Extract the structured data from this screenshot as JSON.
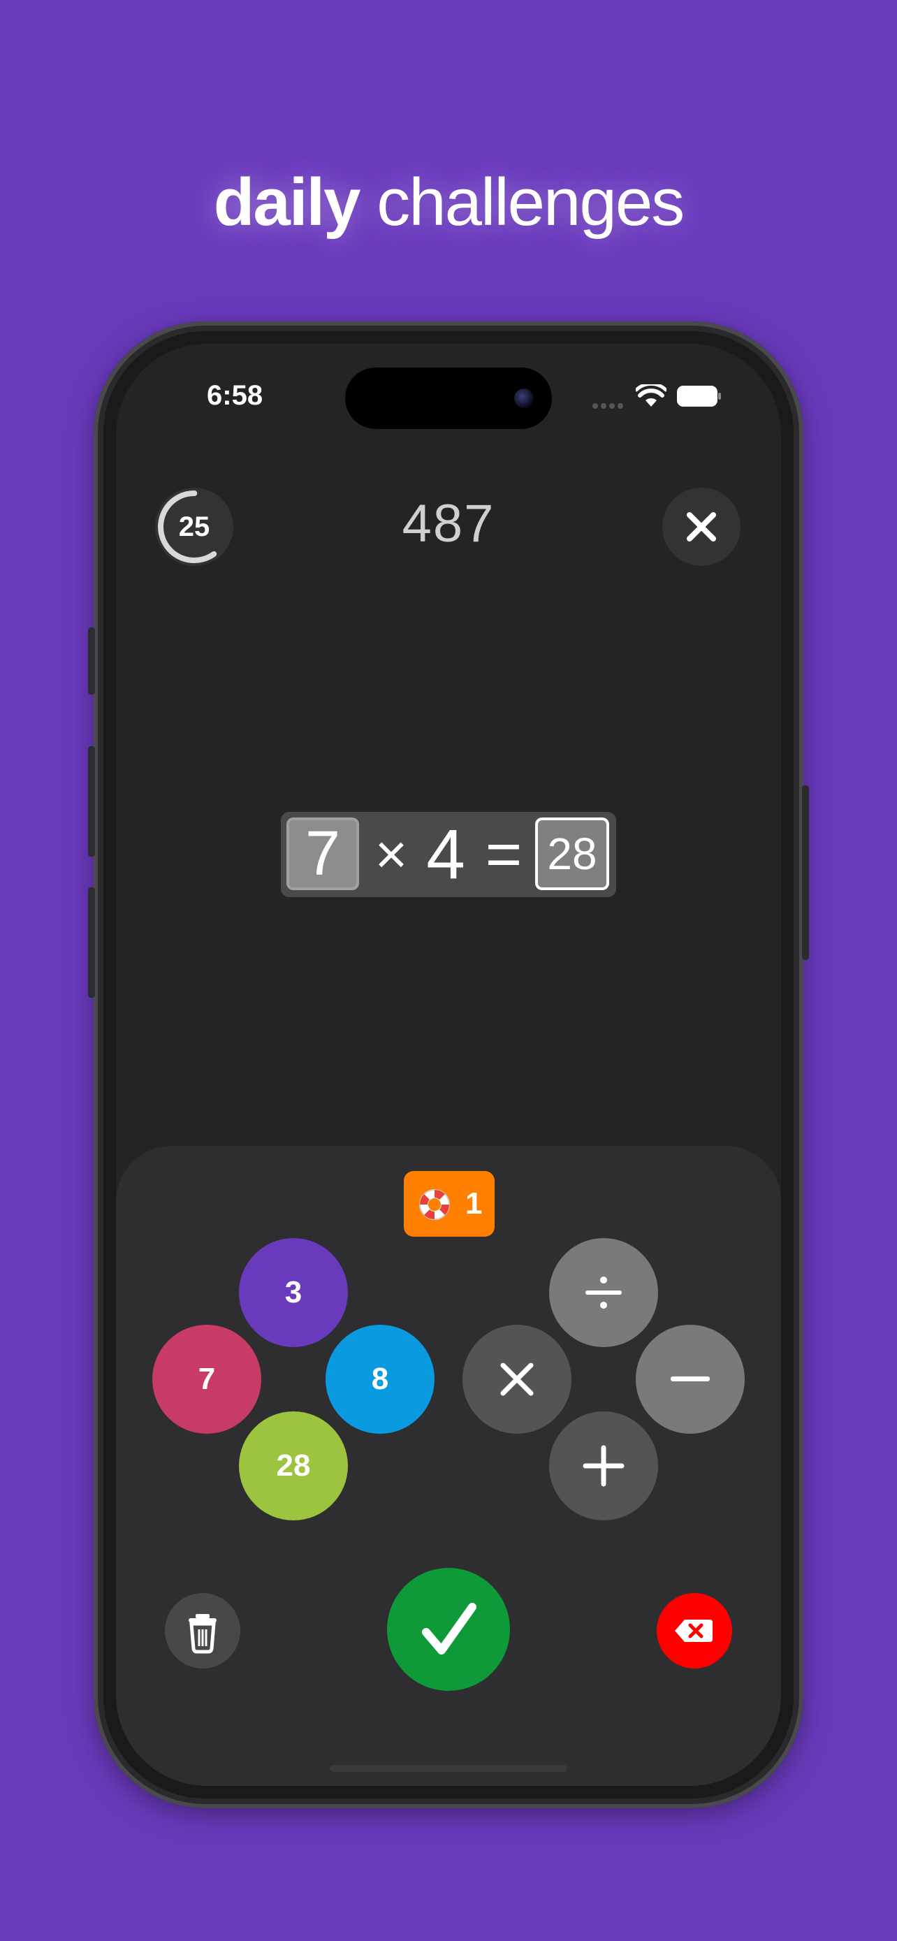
{
  "headline": {
    "bold": "daily",
    "light": " challenges"
  },
  "status_bar": {
    "time": "6:58",
    "icons": [
      "cellular-icon",
      "wifi-icon",
      "battery-icon"
    ]
  },
  "game": {
    "timer": "25",
    "timer_progress": 0.6,
    "score": "487",
    "close_icon": "close-icon"
  },
  "equation": {
    "operand_a": "7",
    "operator": "×",
    "operand_b": "4",
    "equals": "=",
    "result": "28"
  },
  "hint": {
    "icon": "lifebuoy-icon",
    "count": "1"
  },
  "numbers": [
    {
      "value": "3",
      "color": "#6a3abd"
    },
    {
      "value": "7",
      "color": "#c83b64"
    },
    {
      "value": "8",
      "color": "#0a9ae0"
    },
    {
      "value": "28",
      "color": "#9dc43e"
    }
  ],
  "operators": [
    {
      "name": "divide-icon",
      "color": "#7a7a7c"
    },
    {
      "name": "multiply-icon",
      "color": "#545456"
    },
    {
      "name": "minus-icon",
      "color": "#7a7a7c"
    },
    {
      "name": "plus-icon",
      "color": "#545456"
    }
  ],
  "actions": {
    "clear_icon": "trash-icon",
    "submit_icon": "checkmark-icon",
    "delete_icon": "backspace-icon"
  },
  "colors": {
    "background": "#6a3abd",
    "submit": "#0e9a38",
    "delete": "#ff0000",
    "hint": "#ff7f00"
  }
}
